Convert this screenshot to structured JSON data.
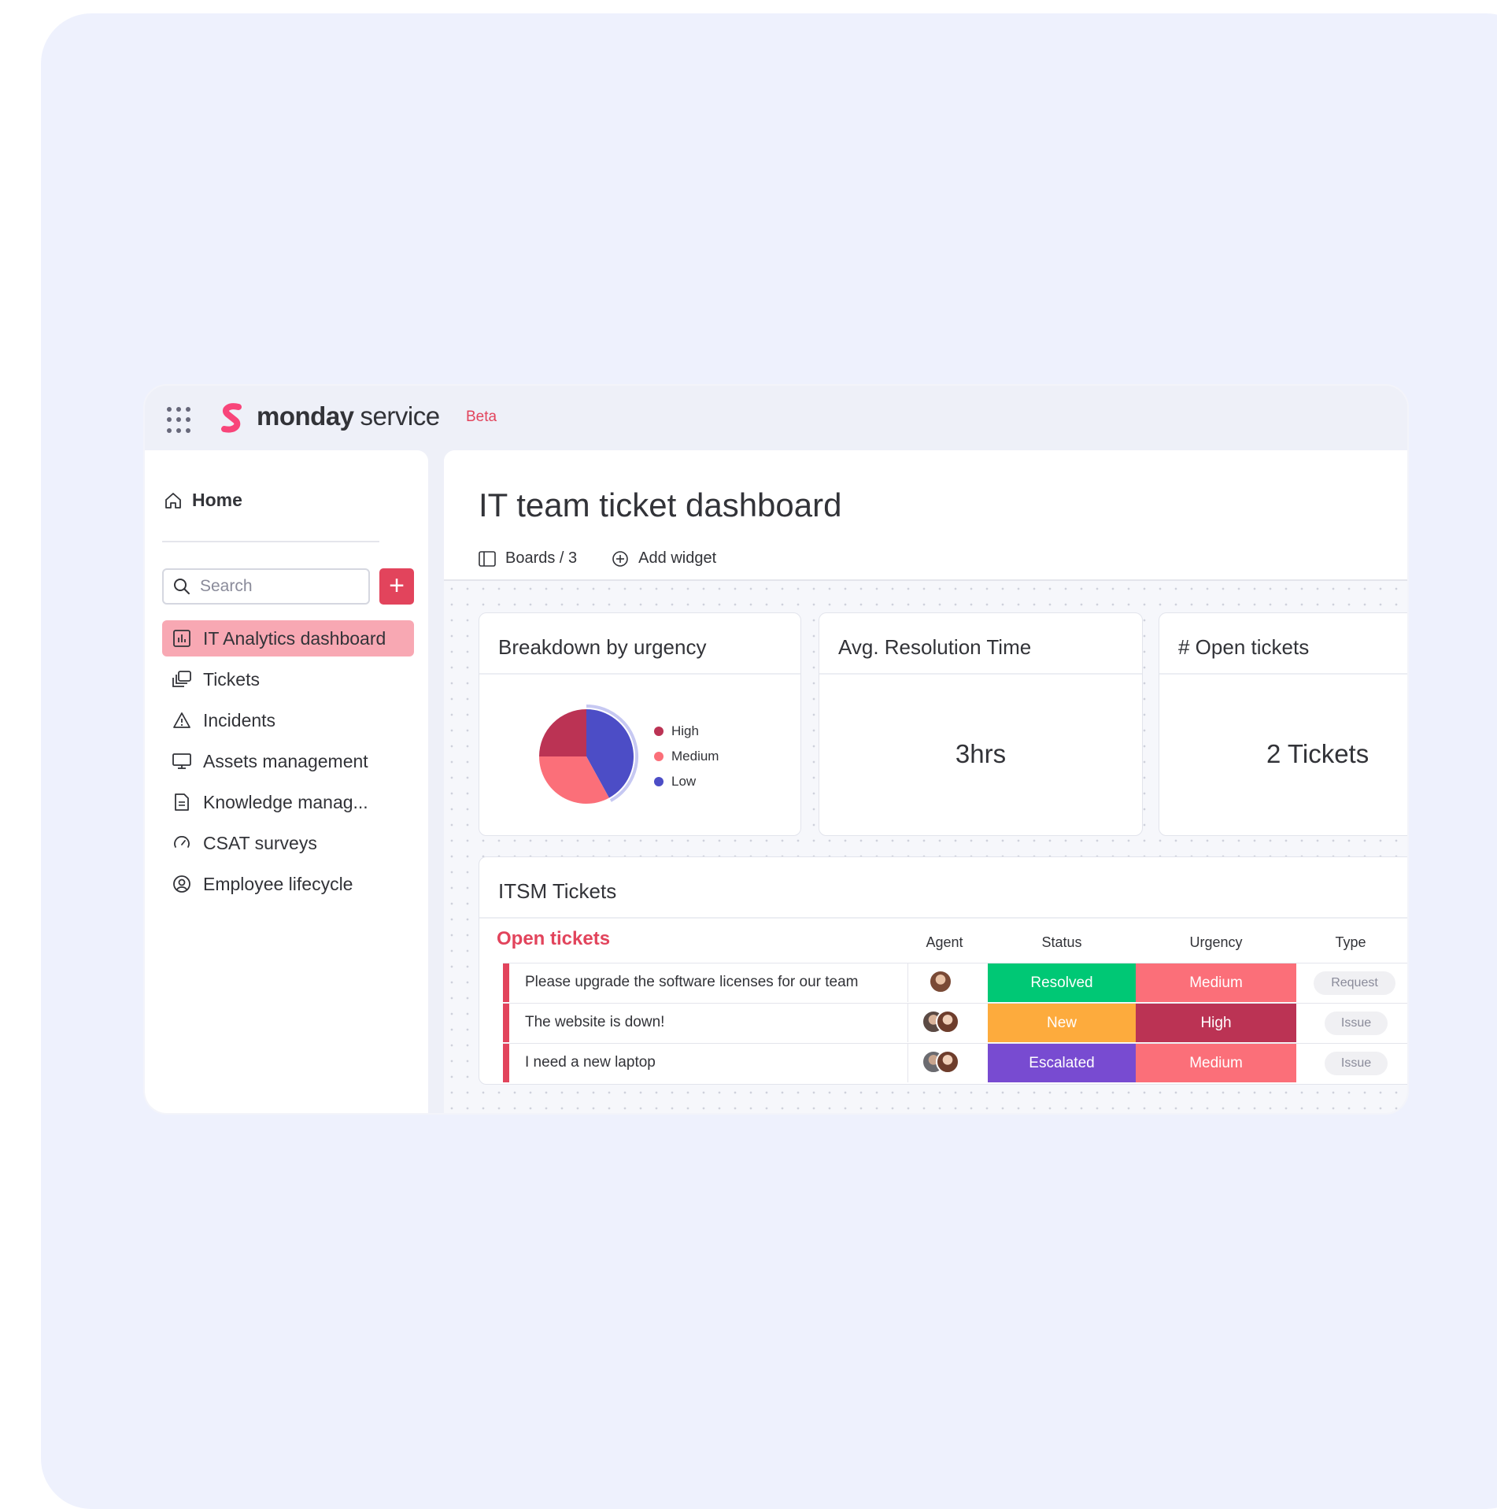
{
  "brand": {
    "name_bold": "monday",
    "name_light": "service",
    "badge": "Beta"
  },
  "sidebar": {
    "home_label": "Home",
    "search_placeholder": "Search",
    "add_label": "+",
    "items": [
      {
        "label": "IT Analytics dashboard",
        "icon": "bar-chart-icon",
        "active": true
      },
      {
        "label": "Tickets",
        "icon": "stacked-cards-icon",
        "active": false
      },
      {
        "label": "Incidents",
        "icon": "warning-icon",
        "active": false
      },
      {
        "label": "Assets management",
        "icon": "monitor-icon",
        "active": false
      },
      {
        "label": "Knowledge manag...",
        "icon": "document-icon",
        "active": false
      },
      {
        "label": "CSAT surveys",
        "icon": "gauge-icon",
        "active": false
      },
      {
        "label": "Employee lifecycle",
        "icon": "user-circle-icon",
        "active": false
      }
    ]
  },
  "main": {
    "title": "IT team ticket dashboard",
    "toolbar": {
      "boards_label": "Boards / 3",
      "add_widget_label": "Add widget"
    }
  },
  "widgets": {
    "urgency": {
      "title": "Breakdown by urgency",
      "legend": [
        "High",
        "Medium",
        "Low"
      ]
    },
    "resolution": {
      "title": "Avg. Resolution Time",
      "value": "3hrs"
    },
    "open": {
      "title": "# Open tickets",
      "value": "2 Tickets"
    }
  },
  "chart_data": {
    "type": "pie",
    "categories": [
      "High",
      "Medium",
      "Low"
    ],
    "values": [
      25,
      33,
      42
    ],
    "colors": [
      "#bb3354",
      "#fb6f79",
      "#4c4dc6"
    ]
  },
  "table": {
    "title": "ITSM Tickets",
    "group": "Open tickets",
    "columns": {
      "agent": "Agent",
      "status": "Status",
      "urgency": "Urgency",
      "type": "Type"
    },
    "rows": [
      {
        "text": "Please upgrade the software licenses for our team",
        "status": "Resolved",
        "status_color": "#00c875",
        "urgency": "Medium",
        "urgency_color": "#fb6f79",
        "type": "Request",
        "agents": 1
      },
      {
        "text": "The website is down!",
        "status": "New",
        "status_color": "#fdab3d",
        "urgency": "High",
        "urgency_color": "#bb3354",
        "type": "Issue",
        "agents": 2
      },
      {
        "text": "I need a new laptop",
        "status": "Escalated",
        "status_color": "#784bd1",
        "urgency": "Medium",
        "urgency_color": "#fb6f79",
        "type": "Issue",
        "agents": 2
      }
    ]
  }
}
